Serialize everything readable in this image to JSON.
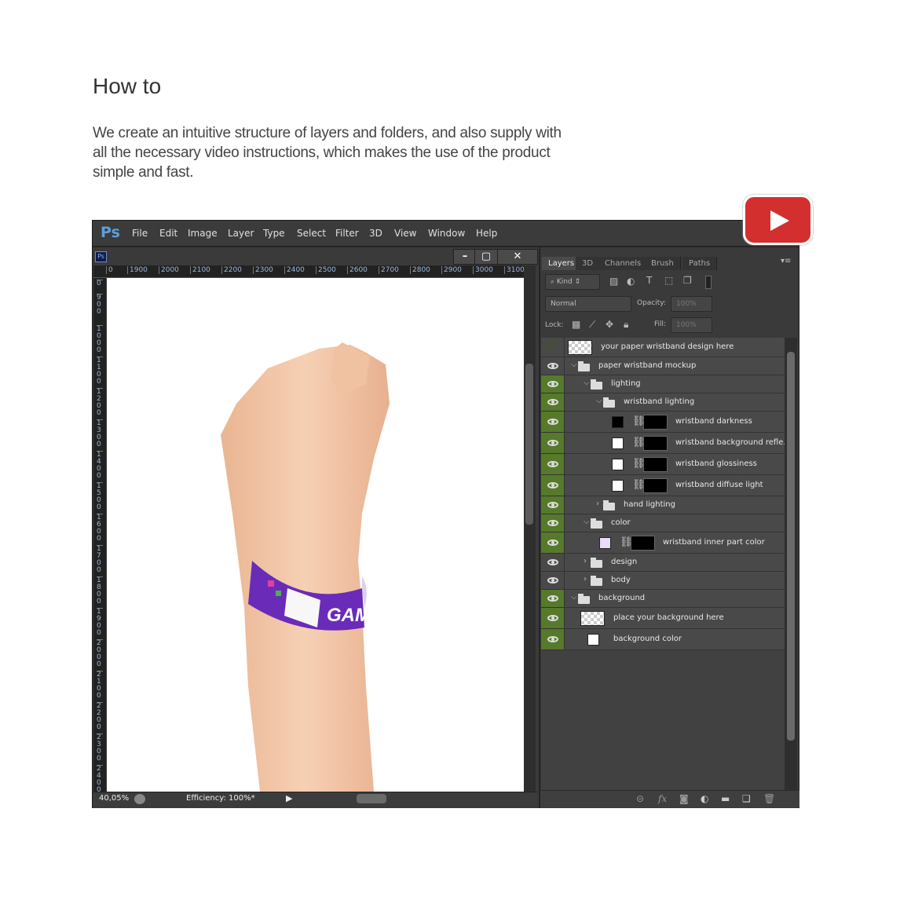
{
  "heading": "How to",
  "description": "We create an intuitive structure of layers and folders, and also supply with all the necessary video instructions, which makes the use of the product simple and fast.",
  "youtube": {
    "icon": "youtube-play-icon",
    "color": "#d32f2f"
  },
  "app": {
    "logo": "Ps",
    "menu": [
      "File",
      "Edit",
      "Image",
      "Layer",
      "Type",
      "Select",
      "Filter",
      "3D",
      "View",
      "Window",
      "Help"
    ]
  },
  "document": {
    "icon_label": "Ps",
    "hruler": [
      "0",
      "1900",
      "2000",
      "2100",
      "2200",
      "2300",
      "2400",
      "2500",
      "2600",
      "2700",
      "2800",
      "2900",
      "3000",
      "3100"
    ],
    "vruler": [
      "0",
      "900",
      "1000",
      "1100",
      "1200",
      "1300",
      "1400",
      "1500",
      "1600",
      "1700",
      "1800",
      "1900",
      "2000",
      "2100",
      "2200",
      "2300",
      "2400"
    ],
    "zoom": "40,05%",
    "efficiency": "Efficiency: 100%*",
    "wristband_text": "GAMI"
  },
  "panel": {
    "tabs": [
      "Layers",
      "3D",
      "Channels",
      "Brush",
      "Paths"
    ],
    "filter_kind": "Kind",
    "blend_mode": "Normal",
    "opacity_label": "Opacity:",
    "opacity": "100%",
    "lock_label": "Lock:",
    "fill_label": "Fill:",
    "fill": "100%",
    "accent": "#56792b",
    "layers": [
      {
        "name": "your paper wristband design here",
        "type": "smart",
        "level": 0,
        "visible": false
      },
      {
        "name": "paper wristband mockup",
        "type": "group",
        "level": 0,
        "expanded": true,
        "visible": true,
        "eye_highlight": false
      },
      {
        "name": "lighting",
        "type": "group",
        "level": 1,
        "expanded": true,
        "visible": true
      },
      {
        "name": "wristband lighting",
        "type": "group",
        "level": 2,
        "expanded": true,
        "visible": true
      },
      {
        "name": "wristband darkness",
        "type": "fill",
        "level": 3,
        "color": "#000000",
        "visible": true
      },
      {
        "name": "wristband background refle...",
        "type": "fill",
        "level": 3,
        "color": "#ffffff",
        "visible": true
      },
      {
        "name": "wristband glossiness",
        "type": "fill",
        "level": 3,
        "color": "#ffffff",
        "visible": true
      },
      {
        "name": "wristband diffuse light",
        "type": "fill",
        "level": 3,
        "color": "#ffffff",
        "visible": true
      },
      {
        "name": "hand lighting",
        "type": "group",
        "level": 2,
        "expanded": false,
        "visible": true
      },
      {
        "name": "color",
        "type": "group",
        "level": 1,
        "expanded": true,
        "visible": true
      },
      {
        "name": "wristband inner part color",
        "type": "fill",
        "level": 2,
        "color": "#e8dcf8",
        "visible": true
      },
      {
        "name": "design",
        "type": "group",
        "level": 1,
        "expanded": false,
        "visible": true,
        "eye_highlight": false
      },
      {
        "name": "body",
        "type": "group",
        "level": 1,
        "expanded": false,
        "visible": true,
        "eye_highlight": false
      },
      {
        "name": "background",
        "type": "group",
        "level": 0,
        "expanded": true,
        "visible": true
      },
      {
        "name": "place your background here",
        "type": "pixel",
        "level": 1,
        "visible": true
      },
      {
        "name": "background color",
        "type": "solid",
        "level": 1,
        "color": "#ffffff",
        "visible": true
      }
    ]
  }
}
